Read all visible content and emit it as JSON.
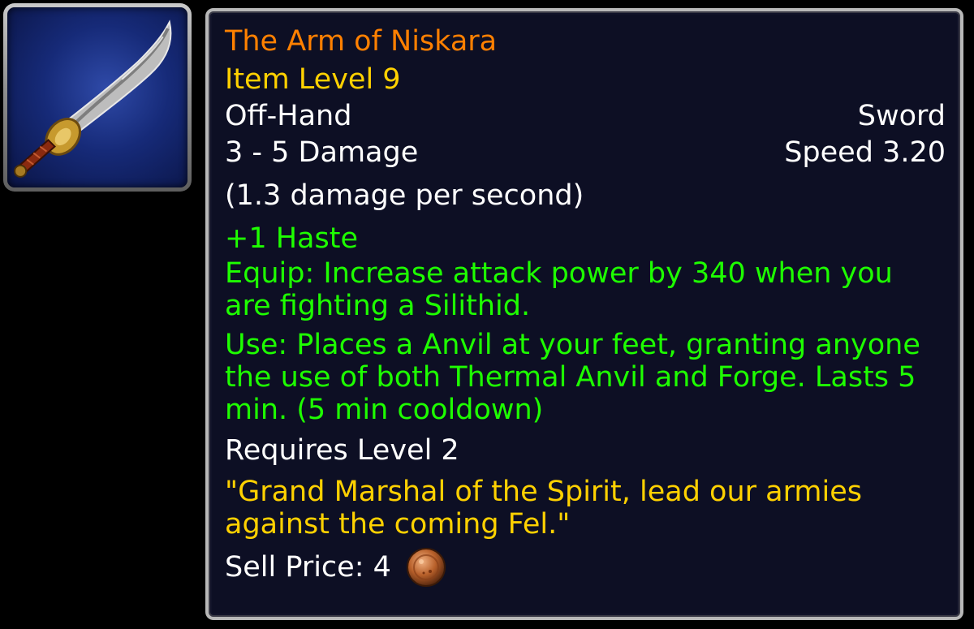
{
  "item": {
    "name": "The Arm of Niskara",
    "item_level": "Item Level 9",
    "slot": "Off-Hand",
    "type": "Sword",
    "damage": "3 - 5 Damage",
    "speed": "Speed 3.20",
    "dps": "(1.3 damage per second)",
    "stat_haste": "+1 Haste",
    "equip_effect": "Equip: Increase attack power by 340 when you are fighting a Silithid.",
    "use_effect": "Use: Places a Anvil at your feet, granting anyone the use of both Thermal Anvil and Forge. Lasts 5 min. (5 min cooldown)",
    "requirement": "Requires Level 2",
    "flavor_text": "\"Grand Marshal of the Spirit, lead our armies against the coming Fel.\"",
    "sell_price_label": "Sell Price: 4",
    "sell_price_coin_icon": "copper-coin-icon",
    "item_icon": "sword-icon"
  },
  "colors": {
    "quality_orange": "#ff8000",
    "gold_text": "#ffd100",
    "green_text": "#1eff00",
    "white_text": "#ffffff",
    "tooltip_background": "#0d0f24",
    "tooltip_border": "#b8b8b8"
  }
}
